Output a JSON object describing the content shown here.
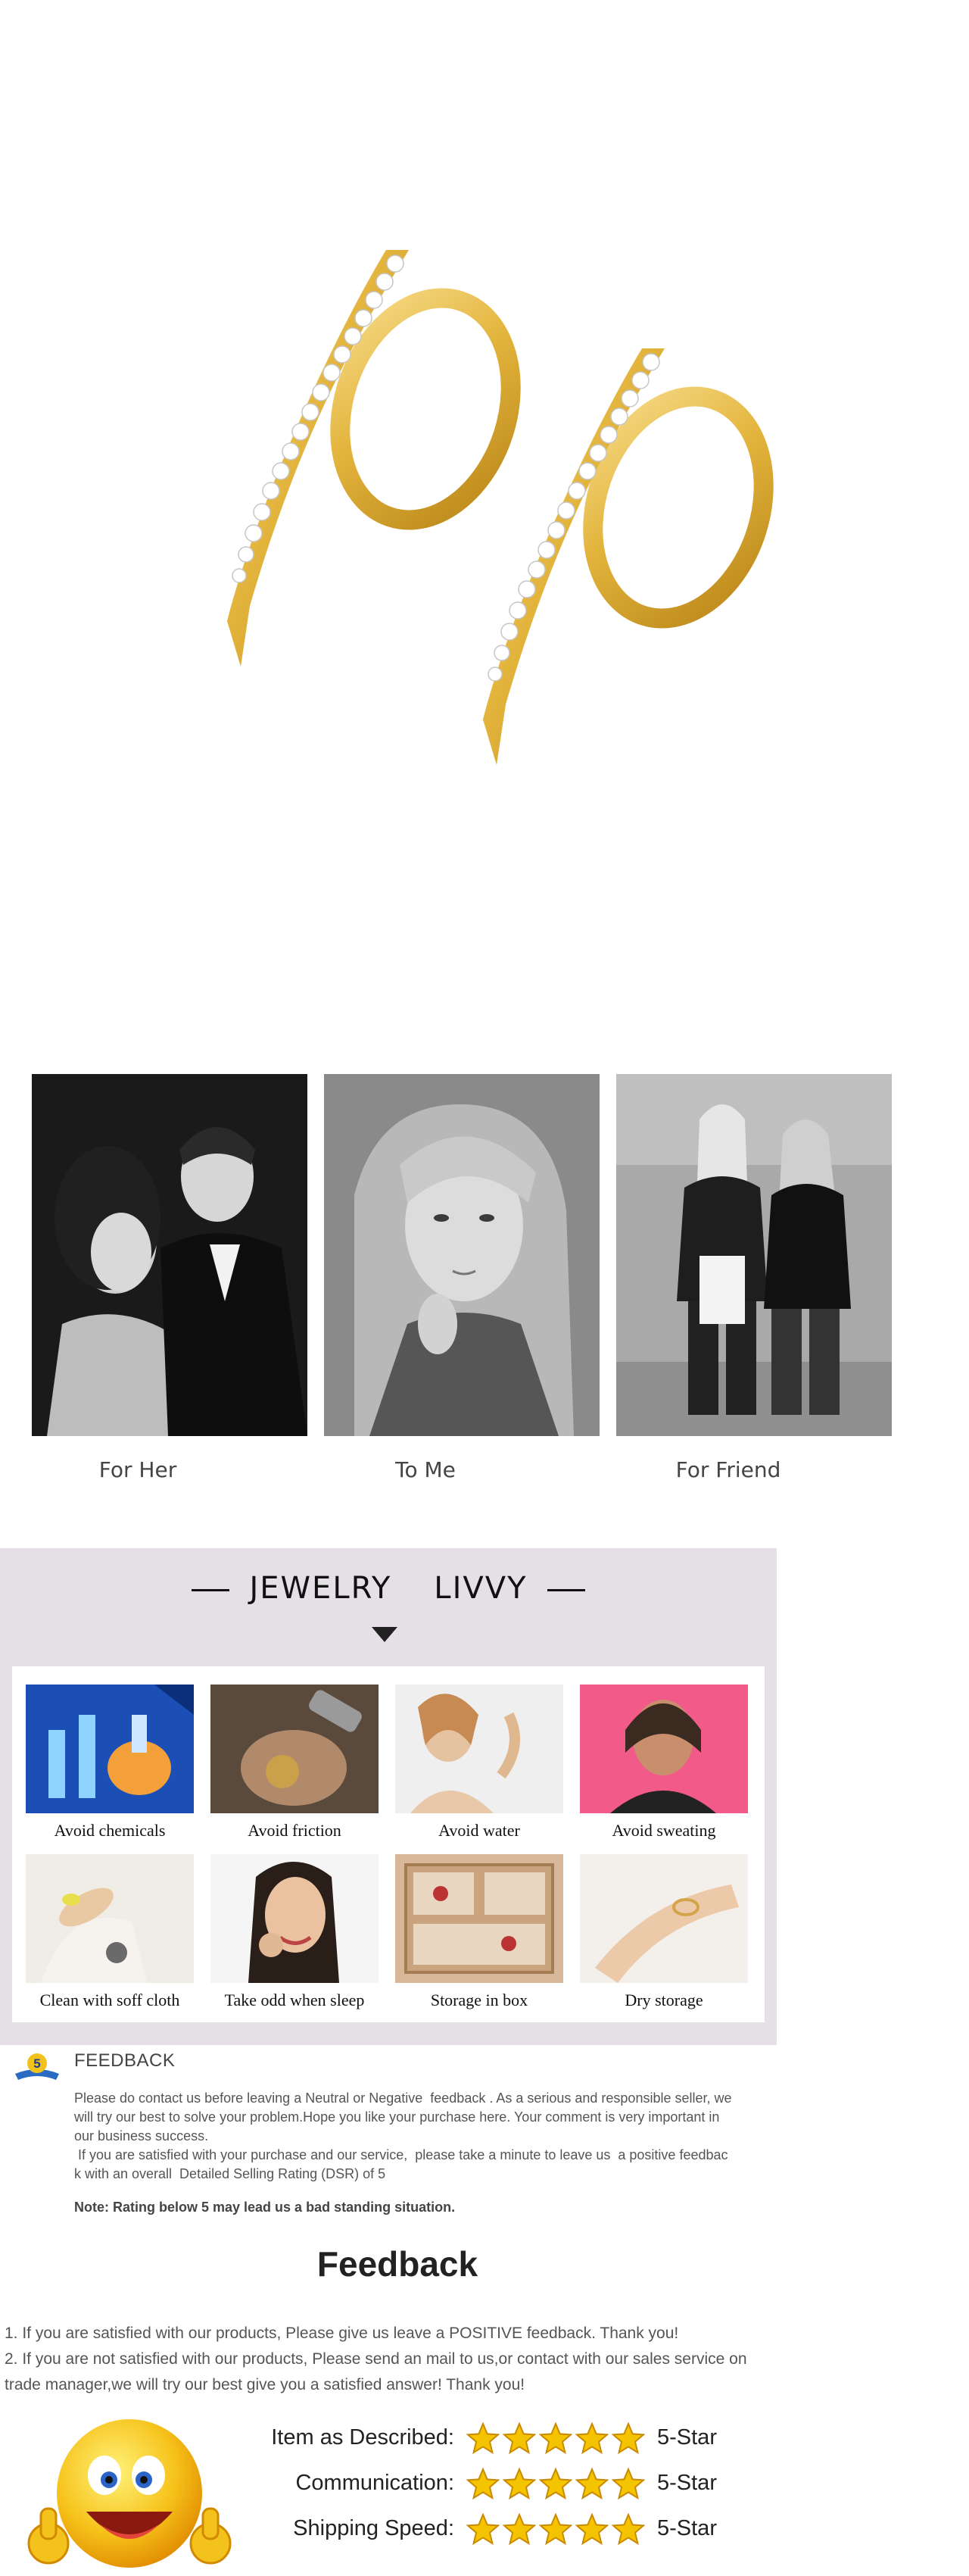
{
  "product": {
    "image": "gold-hook-huggie-earrings-with-crystals"
  },
  "gift": {
    "items": [
      {
        "caption": "For Her",
        "photo": "couple-photo"
      },
      {
        "caption": "To Me",
        "photo": "woman-portrait-photo"
      },
      {
        "caption": "For Friend",
        "photo": "friends-walking-photo"
      }
    ]
  },
  "care": {
    "brand_left": "JEWELRY",
    "brand_right": "LIVVY",
    "items": [
      {
        "label": "Avoid chemicals",
        "icon": "chemicals-photo"
      },
      {
        "label": "Avoid friction",
        "icon": "friction-photo"
      },
      {
        "label": "Avoid water",
        "icon": "water-photo"
      },
      {
        "label": "Avoid sweating",
        "icon": "sweating-photo"
      },
      {
        "label": "Clean with soff cloth",
        "icon": "cloth-photo"
      },
      {
        "label": "Take odd when sleep",
        "icon": "sleep-photo"
      },
      {
        "label": "Storage in box",
        "icon": "box-photo"
      },
      {
        "label": "Dry storage",
        "icon": "ring-photo"
      }
    ]
  },
  "feedback_notice": {
    "badge": "5",
    "title": "FEEDBACK",
    "text": "Please do contact us before leaving a Neutral or Negative  feedback . As a serious and responsible seller, we\nwill try our best to solve your problem.Hope you like your purchase here. Your comment is very important in\nour business success.\n If you are satisfied with your purchase and our service,  please take a minute to leave us  a positive feedbac\nk with an overall  Detailed Selling Rating (DSR) of 5",
    "note": "Note: Rating below 5 may lead us a bad standing situation."
  },
  "feedback": {
    "heading": "Feedback",
    "line1": "1. If you are satisfied with our products, Please give us leave a POSITIVE feedback. Thank you!",
    "line2": "2. If you are not satisfied with our products, Please send an mail to us,or contact with our sales service on",
    "line3": "trade manager,we will try our best give you a satisfied answer! Thank you!",
    "ratings": [
      {
        "label": "Item as Described:",
        "stars": 5,
        "value": "5-Star"
      },
      {
        "label": "Communication:",
        "stars": 5,
        "value": "5-Star"
      },
      {
        "label": "Shipping Speed:",
        "stars": 5,
        "value": "5-Star"
      }
    ]
  },
  "colors": {
    "gold": "#e3b43c",
    "star_fill": "#f5c400",
    "star_stroke": "#c98a00",
    "care_panel": "#e4e0e5"
  }
}
